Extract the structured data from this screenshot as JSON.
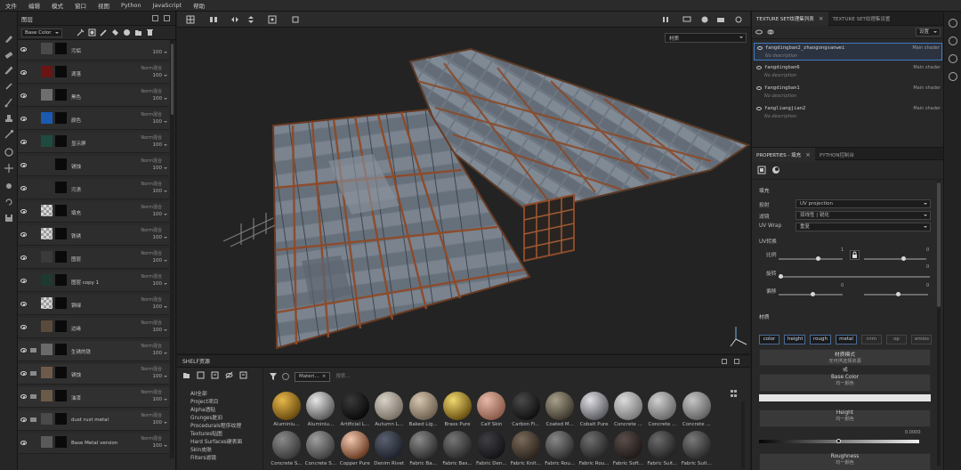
{
  "menubar": [
    "文件",
    "编辑",
    "模式",
    "窗口",
    "视图",
    "Python",
    "JavaScript",
    "帮助"
  ],
  "layers": {
    "title": "图层",
    "channel": "Base Color",
    "rows": [
      {
        "name": "污垢",
        "blend": "",
        "opacity": "100",
        "type": "layer",
        "thumb": "#4a4a4a"
      },
      {
        "name": "滴落",
        "blend": "Norm混合",
        "opacity": "100",
        "type": "layer",
        "thumb": "#6a1414"
      },
      {
        "name": "黑色",
        "blend": "Norm混合",
        "opacity": "100",
        "type": "layer",
        "thumb": "#6e6e6e"
      },
      {
        "name": "颜色",
        "blend": "Norm混合",
        "opacity": "100",
        "type": "layer",
        "thumb": "#1a5ab0"
      },
      {
        "name": "显示屏",
        "blend": "Norm混合",
        "opacity": "100",
        "type": "layer",
        "thumb": "#1e4a42"
      },
      {
        "name": "锈蚀",
        "blend": "Norm混合",
        "opacity": "100",
        "type": "layer",
        "thumb": "#2e2e2e"
      },
      {
        "name": "污渍",
        "blend": "Norm混合",
        "opacity": "100",
        "type": "layer",
        "thumb": "#2e2e2e"
      },
      {
        "name": "填充",
        "blend": "Norm混合",
        "opacity": "100",
        "type": "layer",
        "thumb": "checker"
      },
      {
        "name": "铁锈",
        "blend": "Norm混合",
        "opacity": "100",
        "type": "layer",
        "thumb": "checker"
      },
      {
        "name": "图层",
        "blend": "Norm混合",
        "opacity": "100",
        "type": "layer",
        "thumb": "#3a3a3a"
      },
      {
        "name": "图层 copy 1",
        "blend": "Norm混合",
        "opacity": "100",
        "type": "layer",
        "thumb": "#1e3a30"
      },
      {
        "name": "铜绿",
        "blend": "Norm混合",
        "opacity": "100",
        "type": "layer",
        "thumb": "checker"
      },
      {
        "name": "边缘",
        "blend": "Norm混合",
        "opacity": "100",
        "type": "layer",
        "thumb": "#5a4a3c"
      },
      {
        "name": "生锈的铁",
        "blend": "Norm混合",
        "opacity": "100",
        "type": "folder",
        "thumb": "#6a6a6a"
      },
      {
        "name": "锈蚀",
        "blend": "Norm混合",
        "opacity": "100",
        "type": "folder",
        "thumb": "#6e5a4a"
      },
      {
        "name": "油漆",
        "blend": "Norm混合",
        "opacity": "100",
        "type": "folder",
        "thumb": "#6a5a48"
      },
      {
        "name": "dust rust metal",
        "blend": "Norm混合",
        "opacity": "100",
        "type": "folder",
        "thumb": "#4a4a4a"
      },
      {
        "name": "Base Metal version",
        "blend": "Norm混合",
        "opacity": "100",
        "type": "layer",
        "thumb": "#5a5a5a"
      }
    ]
  },
  "viewport": {
    "material_mode": "材质"
  },
  "shelf": {
    "title": "SHELF资源",
    "filter_chip": "Materi...",
    "search_placeholder": "搜索...",
    "categories": [
      "All全部",
      "Project项目",
      "Alpha透贴",
      "Grunges脏旧",
      "Procedurals程序纹理",
      "Textures贴图",
      "Hard Surfaces硬表面",
      "Skin皮肤",
      "Filters滤镜"
    ],
    "row1": [
      {
        "label": "Aluminiu...",
        "c1": "#e6b84a",
        "c2": "#6a4a10"
      },
      {
        "label": "Aluminiu...",
        "c1": "#e6e6e6",
        "c2": "#5a5a5a"
      },
      {
        "label": "Artificial L...",
        "c1": "#3a3a3a",
        "c2": "#0a0a0a"
      },
      {
        "label": "Autumn L...",
        "c1": "#d8d2c8",
        "c2": "#7a7066"
      },
      {
        "label": "Baked Lig...",
        "c1": "#d6c6b0",
        "c2": "#6e6050"
      },
      {
        "label": "Brass Pure",
        "c1": "#f0d870",
        "c2": "#6a5010"
      },
      {
        "label": "Calf Skin",
        "c1": "#e6b8a6",
        "c2": "#8a5a4a"
      },
      {
        "label": "Carbon Fi...",
        "c1": "#4a4a4a",
        "c2": "#101010"
      },
      {
        "label": "Coated M...",
        "c1": "#a8a08a",
        "c2": "#3e3a2e"
      },
      {
        "label": "Cobalt Pure",
        "c1": "#e0e0e4",
        "c2": "#5a5a62"
      },
      {
        "label": "Concrete ...",
        "c1": "#dcdcdc",
        "c2": "#7a7a7a"
      },
      {
        "label": "Concrete ...",
        "c1": "#d0d0d0",
        "c2": "#6a6a6a"
      },
      {
        "label": "Concrete ...",
        "c1": "#c6c6c6",
        "c2": "#626262"
      }
    ],
    "row2": [
      {
        "label": "Concrete S...",
        "c1": "#8a8a8a",
        "c2": "#3a3a3a"
      },
      {
        "label": "Concrete S...",
        "c1": "#9e9e9e",
        "c2": "#404040"
      },
      {
        "label": "Copper Pure",
        "c1": "#f2c8b0",
        "c2": "#6a3a22"
      },
      {
        "label": "Denim Rivet",
        "c1": "#5a6070",
        "c2": "#1e222c"
      },
      {
        "label": "Fabric Ba...",
        "c1": "#8a8a8a",
        "c2": "#2e2e2e"
      },
      {
        "label": "Fabric Bas...",
        "c1": "#767676",
        "c2": "#2a2a2a"
      },
      {
        "label": "Fabric Den...",
        "c1": "#3e3e44",
        "c2": "#141418"
      },
      {
        "label": "Fabric Knit...",
        "c1": "#7a6a5a",
        "c2": "#2e261e"
      },
      {
        "label": "Fabric Rou...",
        "c1": "#888888",
        "c2": "#303030"
      },
      {
        "label": "Fabric Rou...",
        "c1": "#6e6e6e",
        "c2": "#262626"
      },
      {
        "label": "Fabric Soft...",
        "c1": "#5a4e4a",
        "c2": "#201a18"
      },
      {
        "label": "Fabric Suit...",
        "c1": "#6a6a6a",
        "c2": "#242424"
      },
      {
        "label": "Fabric Suit...",
        "c1": "#7a7a7a",
        "c2": "#2a2a2a"
      }
    ]
  },
  "texture_sets": {
    "tab_list": "TEXTURE SET纹理集列表",
    "tab_settings": "TEXTURE SET纹理集设置",
    "settings_label": "设置",
    "items": [
      {
        "name": "fangdingban2_zhaogongsanwei",
        "desc": "No description",
        "shader": "Main shader"
      },
      {
        "name": "fangdingban6",
        "desc": "No description",
        "shader": "Main shader"
      },
      {
        "name": "fangdingban1",
        "desc": "No description",
        "shader": "Main shader"
      },
      {
        "name": "fangliangjian2",
        "desc": "No description",
        "shader": "Main shader"
      }
    ]
  },
  "properties": {
    "tab_fill": "PROPERTIES - 填充",
    "tab_python": "PYTHON控制台",
    "section_fill": "填充",
    "projection_label": "投射",
    "projection_value": "UV projection",
    "filter_label": "滤镜",
    "filter_value": "双线性 | 锐化",
    "uvwrap_label": "UV Wrap",
    "uvwrap_value": "重复",
    "uv_transform": "UV转换",
    "scale_label": "比例",
    "scale_value": "1",
    "rotation_label": "旋转",
    "rotation_value": "0",
    "offset_label": "偏移",
    "offset_value_1": "0",
    "offset_value_2": "0",
    "scale_value_2": "0",
    "material_label": "材质",
    "channels": [
      "color",
      "height",
      "rough",
      "metal",
      "nrm",
      "op",
      "emiss"
    ],
    "material_mode_title": "材质模式",
    "material_mode_sub": "无可供选择资源",
    "or_label": "或",
    "base_color_title": "Base Color",
    "base_color_sub": "均一颜色",
    "height_title": "Height",
    "height_sub": "均一颜色",
    "height_value": "0.0000",
    "roughness_title": "Roughness",
    "roughness_sub": "均一颜色"
  }
}
